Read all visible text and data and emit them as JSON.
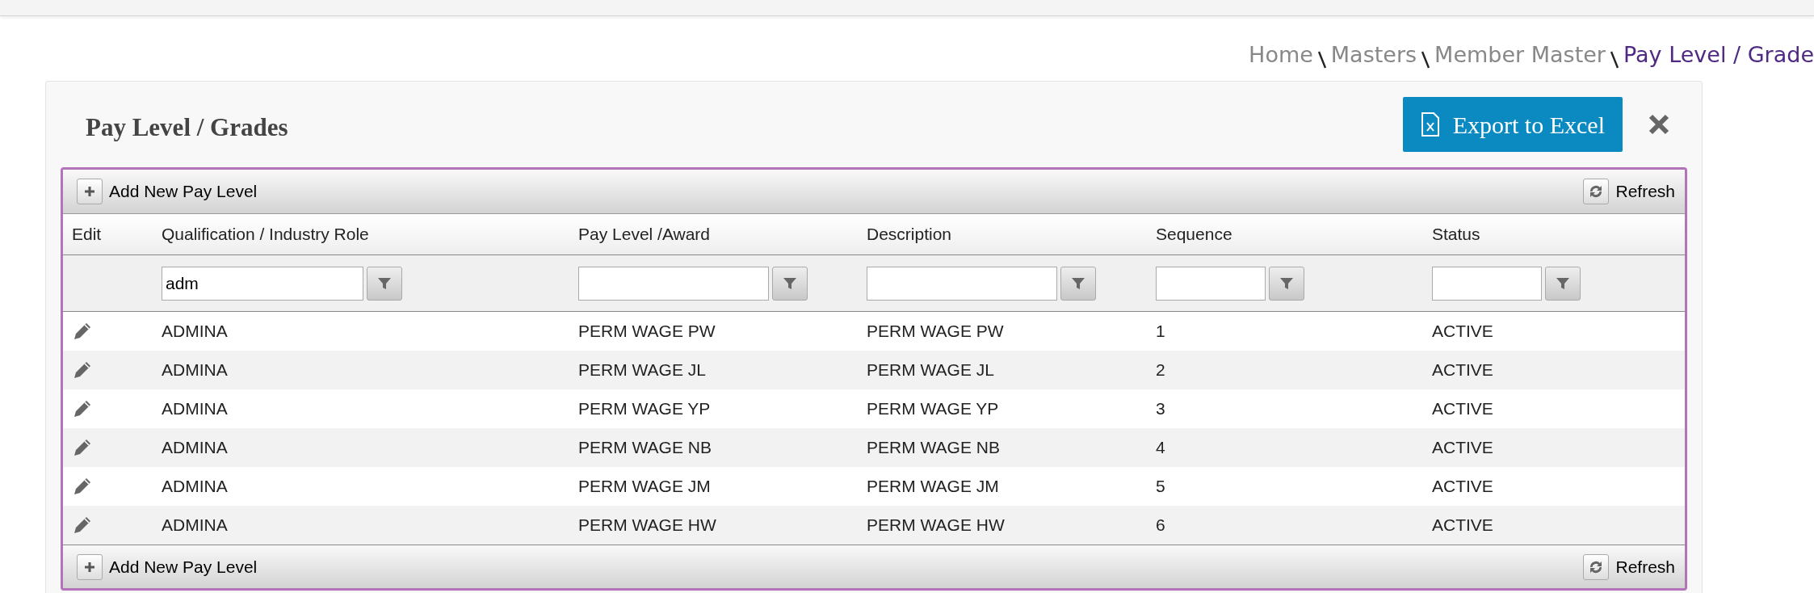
{
  "breadcrumb": [
    {
      "label": "Home",
      "current": false
    },
    {
      "label": "Masters",
      "current": false
    },
    {
      "label": "Member Master",
      "current": false
    },
    {
      "label": "Pay Level / Grade",
      "current": true
    }
  ],
  "panel": {
    "title": "Pay Level / Grades",
    "export_button": "Export to Excel"
  },
  "grid": {
    "top_toolbar": {
      "add": "Add New Pay Level",
      "refresh": "Refresh"
    },
    "columns": [
      {
        "label": "Edit",
        "kind": "action"
      },
      {
        "label": "Qualification / Industry Role",
        "kind": "data",
        "filter_value": "adm"
      },
      {
        "label": "Pay Level /Award",
        "kind": "data"
      },
      {
        "label": "Description",
        "kind": "data"
      },
      {
        "label": "Sequence",
        "kind": "data"
      },
      {
        "label": "Status",
        "kind": "data"
      }
    ],
    "rows": [
      [
        "",
        "ADMINA",
        "PERM WAGE PW",
        "PERM WAGE PW",
        "1",
        "ACTIVE"
      ],
      [
        "",
        "ADMINA",
        "PERM WAGE JL",
        "PERM WAGE JL",
        "2",
        "ACTIVE"
      ],
      [
        "",
        "ADMINA",
        "PERM WAGE YP",
        "PERM WAGE YP",
        "3",
        "ACTIVE"
      ],
      [
        "",
        "ADMINA",
        "PERM WAGE NB",
        "PERM WAGE NB",
        "4",
        "ACTIVE"
      ],
      [
        "",
        "ADMINA",
        "PERM WAGE JM",
        "PERM WAGE JM",
        "5",
        "ACTIVE"
      ],
      [
        "",
        "ADMINA",
        "PERM WAGE HW",
        "PERM WAGE HW",
        "6",
        "ACTIVE"
      ]
    ],
    "bottom_toolbar": {
      "add": "Add New Pay Level",
      "refresh": "Refresh"
    }
  }
}
